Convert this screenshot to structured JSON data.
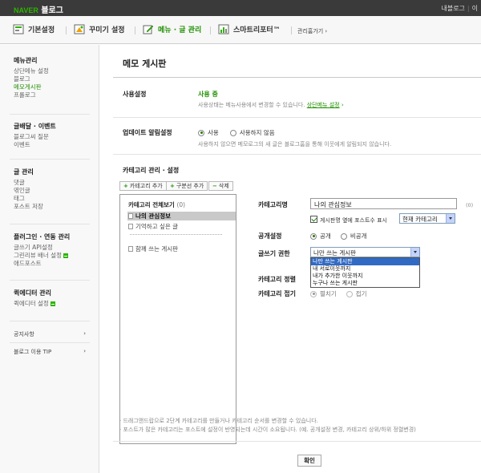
{
  "topbar": {
    "brand_naver": "NAVER",
    "brand_blog": "블로그",
    "links": [
      "내블로그",
      "이"
    ]
  },
  "tabs": [
    {
      "label": "기본설정",
      "icon": "gear-icon"
    },
    {
      "label": "꾸미기 설정",
      "icon": "paint-icon"
    },
    {
      "label": "메뉴 · 글 관리",
      "icon": "pencil-icon",
      "active": true
    },
    {
      "label": "스마트리포터™",
      "icon": "report-icon"
    }
  ],
  "manage_home": "관리홈가기 ›",
  "sidebar": {
    "menu_head": "메뉴관리",
    "menu_items": [
      "상단메뉴 설정",
      "블로그",
      "메모게시판",
      "프롤로그"
    ],
    "write_head": "글배달 · 이벤트",
    "write_items": [
      "블로그씨 질문",
      "이벤트"
    ],
    "post_head": "글 관리",
    "post_items": [
      "댓글",
      "엮인글",
      "태그",
      "포스트 저장"
    ],
    "plugin_head": "플러그인 · 연동 관리",
    "plugin_items": [
      "글쓰기 API설정",
      "그린리뷰 배너 설정",
      "애드포스트"
    ],
    "quick_head": "퀵에디터 관리",
    "quick_items": [
      "퀵에디터 설정"
    ],
    "notice": "공지사항",
    "tips": "블로그 이용 TIP",
    "chevron": "›"
  },
  "main": {
    "title": "메모 게시판",
    "use_label": "사용설정",
    "use_status": "사용 중",
    "use_desc": "사용상태는 메뉴사용에서 변경할 수 있습니다.",
    "use_desc_link": "상단메뉴 설정",
    "use_desc_arrow": "›",
    "notify_label": "업데이트 알림설정",
    "notify_on": "사용",
    "notify_off": "사용하지 않음",
    "notify_desc": "사용하지 않으면 메모로그의 새 글은 블로그홈을 통해 이웃에게 알림되지 않습니다.",
    "cat_title": "카테고리 관리 · 설정",
    "btn_add_cat": "카테고리 추가",
    "btn_add_sep": "구분선 추가",
    "btn_delete": "삭제",
    "btn_add_symbol": "+",
    "btn_delete_symbol": "−",
    "tree_head": "카테고리 전체보기",
    "tree_count": "(0)",
    "tree_items": [
      "나의 관심정보",
      "기억하고 싶은 글",
      "함께 쓰는 게시판"
    ],
    "name_label": "카테고리명",
    "name_value": "나의 관심정보",
    "name_count": "(0)",
    "show_top_label": "게시판명 옆에 포스트수 표시",
    "show_top_select": "현재 카테고리",
    "public_label": "공개설정",
    "public_on": "공개",
    "public_off": "비공개",
    "write_label": "글쓰기 권한",
    "write_select": "나만 쓰는 게시판",
    "write_options": [
      "나만 쓰는 게시판",
      "내 서로이웃까지",
      "내가 추가한 이웃까지",
      "누구나 쓰는 게시판"
    ],
    "sort_label": "카테고리 정렬",
    "fold_label": "카테고리 접기",
    "fold_open": "펼치기",
    "fold_close": "접기",
    "note1": "· 드래그앤드랍으로 2단계 카테고리를 만들거나 카테고리 순서를 변경할 수 있습니다.",
    "note2": "· 포스트가 많은 카테고리는 포스트에 설정이 반영되는데 시간이 소요됩니다. (예. 공개설정 변경, 카테고리 상위/하위 정렬변경)",
    "confirm": "확인"
  },
  "colors": {
    "accent_green": "#1f8f00",
    "topbar": "#3a3a3a",
    "select_highlight": "#316ac5"
  }
}
